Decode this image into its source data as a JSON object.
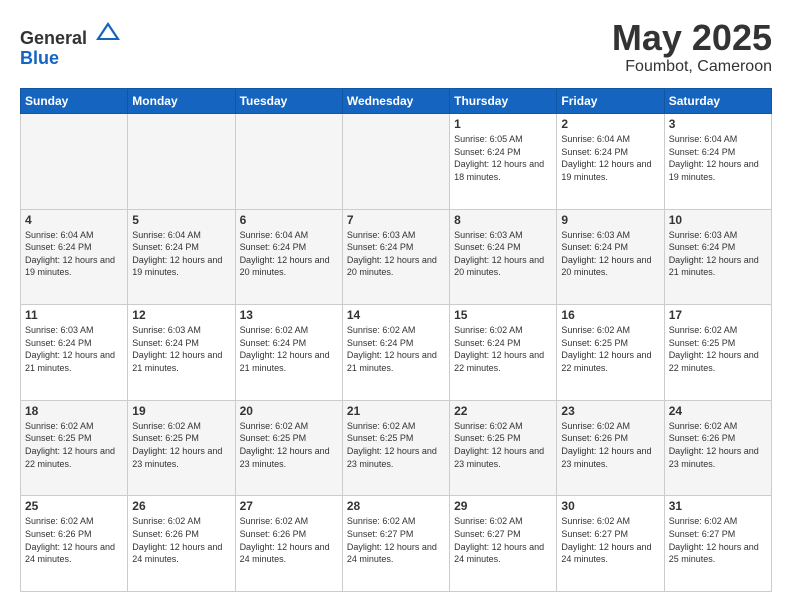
{
  "header": {
    "logo": {
      "general": "General",
      "blue": "Blue"
    },
    "title": "May 2025",
    "location": "Foumbot, Cameroon"
  },
  "weekdays": [
    "Sunday",
    "Monday",
    "Tuesday",
    "Wednesday",
    "Thursday",
    "Friday",
    "Saturday"
  ],
  "weeks": [
    {
      "days": [
        {
          "empty": true
        },
        {
          "empty": true
        },
        {
          "empty": true
        },
        {
          "empty": true
        },
        {
          "num": "1",
          "sunrise": "6:05 AM",
          "sunset": "6:24 PM",
          "daylight": "12 hours and 18 minutes."
        },
        {
          "num": "2",
          "sunrise": "6:04 AM",
          "sunset": "6:24 PM",
          "daylight": "12 hours and 19 minutes."
        },
        {
          "num": "3",
          "sunrise": "6:04 AM",
          "sunset": "6:24 PM",
          "daylight": "12 hours and 19 minutes."
        }
      ]
    },
    {
      "days": [
        {
          "num": "4",
          "sunrise": "6:04 AM",
          "sunset": "6:24 PM",
          "daylight": "12 hours and 19 minutes."
        },
        {
          "num": "5",
          "sunrise": "6:04 AM",
          "sunset": "6:24 PM",
          "daylight": "12 hours and 19 minutes."
        },
        {
          "num": "6",
          "sunrise": "6:04 AM",
          "sunset": "6:24 PM",
          "daylight": "12 hours and 20 minutes."
        },
        {
          "num": "7",
          "sunrise": "6:03 AM",
          "sunset": "6:24 PM",
          "daylight": "12 hours and 20 minutes."
        },
        {
          "num": "8",
          "sunrise": "6:03 AM",
          "sunset": "6:24 PM",
          "daylight": "12 hours and 20 minutes."
        },
        {
          "num": "9",
          "sunrise": "6:03 AM",
          "sunset": "6:24 PM",
          "daylight": "12 hours and 20 minutes."
        },
        {
          "num": "10",
          "sunrise": "6:03 AM",
          "sunset": "6:24 PM",
          "daylight": "12 hours and 21 minutes."
        }
      ]
    },
    {
      "days": [
        {
          "num": "11",
          "sunrise": "6:03 AM",
          "sunset": "6:24 PM",
          "daylight": "12 hours and 21 minutes."
        },
        {
          "num": "12",
          "sunrise": "6:03 AM",
          "sunset": "6:24 PM",
          "daylight": "12 hours and 21 minutes."
        },
        {
          "num": "13",
          "sunrise": "6:02 AM",
          "sunset": "6:24 PM",
          "daylight": "12 hours and 21 minutes."
        },
        {
          "num": "14",
          "sunrise": "6:02 AM",
          "sunset": "6:24 PM",
          "daylight": "12 hours and 21 minutes."
        },
        {
          "num": "15",
          "sunrise": "6:02 AM",
          "sunset": "6:24 PM",
          "daylight": "12 hours and 22 minutes."
        },
        {
          "num": "16",
          "sunrise": "6:02 AM",
          "sunset": "6:25 PM",
          "daylight": "12 hours and 22 minutes."
        },
        {
          "num": "17",
          "sunrise": "6:02 AM",
          "sunset": "6:25 PM",
          "daylight": "12 hours and 22 minutes."
        }
      ]
    },
    {
      "days": [
        {
          "num": "18",
          "sunrise": "6:02 AM",
          "sunset": "6:25 PM",
          "daylight": "12 hours and 22 minutes."
        },
        {
          "num": "19",
          "sunrise": "6:02 AM",
          "sunset": "6:25 PM",
          "daylight": "12 hours and 23 minutes."
        },
        {
          "num": "20",
          "sunrise": "6:02 AM",
          "sunset": "6:25 PM",
          "daylight": "12 hours and 23 minutes."
        },
        {
          "num": "21",
          "sunrise": "6:02 AM",
          "sunset": "6:25 PM",
          "daylight": "12 hours and 23 minutes."
        },
        {
          "num": "22",
          "sunrise": "6:02 AM",
          "sunset": "6:25 PM",
          "daylight": "12 hours and 23 minutes."
        },
        {
          "num": "23",
          "sunrise": "6:02 AM",
          "sunset": "6:26 PM",
          "daylight": "12 hours and 23 minutes."
        },
        {
          "num": "24",
          "sunrise": "6:02 AM",
          "sunset": "6:26 PM",
          "daylight": "12 hours and 23 minutes."
        }
      ]
    },
    {
      "days": [
        {
          "num": "25",
          "sunrise": "6:02 AM",
          "sunset": "6:26 PM",
          "daylight": "12 hours and 24 minutes."
        },
        {
          "num": "26",
          "sunrise": "6:02 AM",
          "sunset": "6:26 PM",
          "daylight": "12 hours and 24 minutes."
        },
        {
          "num": "27",
          "sunrise": "6:02 AM",
          "sunset": "6:26 PM",
          "daylight": "12 hours and 24 minutes."
        },
        {
          "num": "28",
          "sunrise": "6:02 AM",
          "sunset": "6:27 PM",
          "daylight": "12 hours and 24 minutes."
        },
        {
          "num": "29",
          "sunrise": "6:02 AM",
          "sunset": "6:27 PM",
          "daylight": "12 hours and 24 minutes."
        },
        {
          "num": "30",
          "sunrise": "6:02 AM",
          "sunset": "6:27 PM",
          "daylight": "12 hours and 24 minutes."
        },
        {
          "num": "31",
          "sunrise": "6:02 AM",
          "sunset": "6:27 PM",
          "daylight": "12 hours and 25 minutes."
        }
      ]
    }
  ]
}
